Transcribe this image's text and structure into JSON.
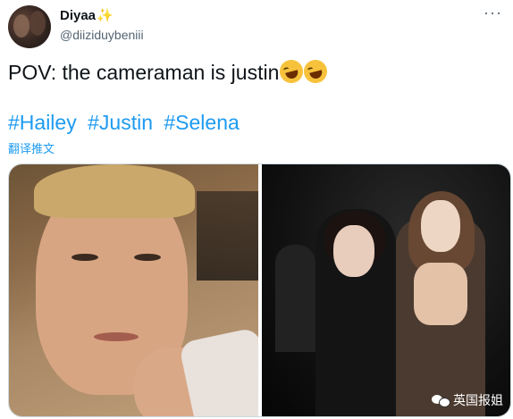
{
  "author": {
    "display_name": "Diyaa",
    "badge_emoji": "✨",
    "handle": "@diiziduybeniii"
  },
  "menu": {
    "more_label": "···"
  },
  "tweet": {
    "text": "POV: the cameraman is justin",
    "emoji": [
      "rolling-on-floor-laughing",
      "rolling-on-floor-laughing"
    ],
    "hashtags": [
      "#Hailey",
      "#Justin",
      "#Selena"
    ],
    "translate_label": "翻译推文"
  },
  "media": {
    "watermark": "英国报姐"
  }
}
